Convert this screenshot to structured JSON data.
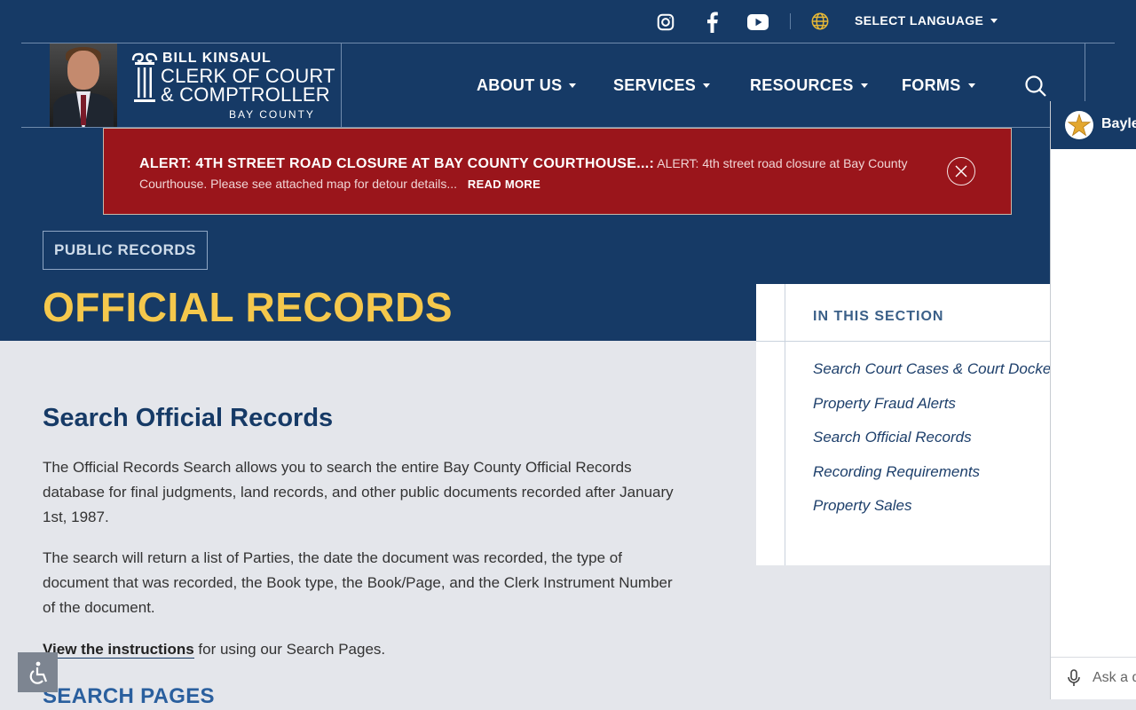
{
  "util": {
    "language_label": "SELECT LANGUAGE"
  },
  "logo": {
    "line1": "BILL KINSAUL",
    "line2": "CLERK OF COURT",
    "line3": "& COMPTROLLER",
    "line4": "BAY COUNTY"
  },
  "nav": {
    "items": [
      "ABOUT US",
      "SERVICES",
      "RESOURCES",
      "FORMS"
    ]
  },
  "alert": {
    "title": "ALERT: 4TH STREET ROAD CLOSURE AT BAY COUNTY COURTHOUSE...:",
    "body": "ALERT: 4th street road closure at Bay County Courthouse. Please see attached map for detour details...",
    "read_more": "READ MORE"
  },
  "breadcrumb": "PUBLIC RECORDS",
  "page_title": "OFFICIAL RECORDS",
  "main": {
    "heading": "Search Official Records",
    "para1": "The Official Records Search allows you to search the entire Bay County Official Records database for final judgments, land records, and other public documents recorded after January 1st, 1987.",
    "para2": "The search will return a list of Parties, the date the document was recorded, the type of document that was recorded, the Book type, the Book/Page, and the Clerk Instrument Number of the document.",
    "instructions_link": "View the instructions",
    "instructions_rest": " for using our Search Pages.",
    "subheading": "SEARCH PAGES"
  },
  "section": {
    "heading": "IN THIS SECTION",
    "links": [
      "Search Court Cases & Court Dockets",
      "Property Fraud Alerts",
      "Search Official Records",
      "Recording Requirements",
      "Property Sales"
    ]
  },
  "chat": {
    "name": "Bayley",
    "placeholder": "Ask a question"
  },
  "colors": {
    "navy": "#163a66",
    "gold": "#f5c84c",
    "alert_red": "#9a151b"
  }
}
